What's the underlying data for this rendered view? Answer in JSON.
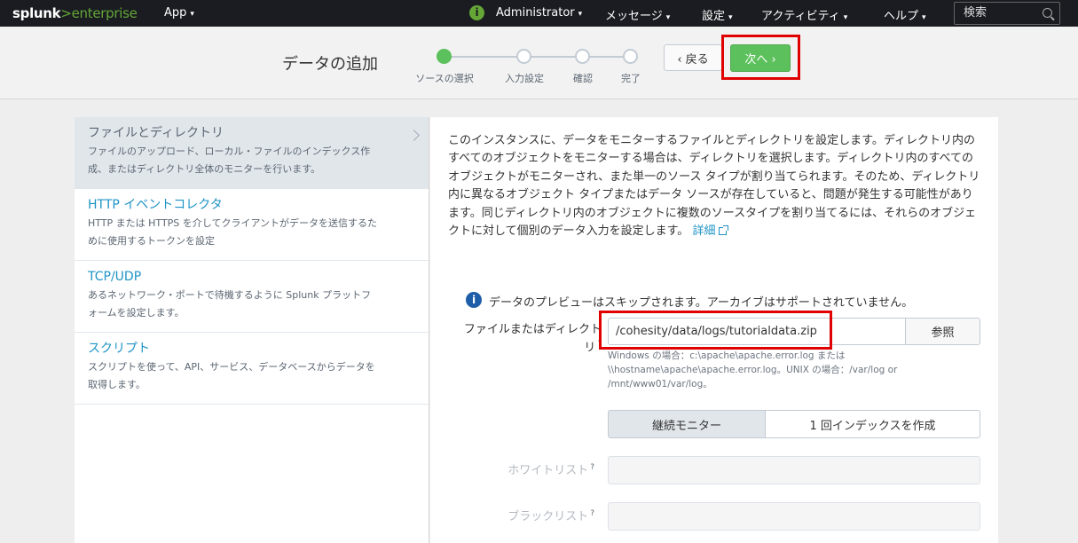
{
  "topbar": {
    "logo_main": "splunk",
    "logo_sep": ">",
    "logo_sub": "enterprise",
    "app_menu": "App",
    "info_glyph": "i",
    "user_menu": "Administrator",
    "messages_menu": "メッセージ",
    "settings_menu": "設定",
    "activity_menu": "アクティビティ",
    "help_menu": "ヘルプ",
    "search_placeholder": "検索",
    "caret": "▾"
  },
  "header": {
    "title": "データの追加",
    "steps": [
      {
        "label": "ソースの選択",
        "state": "active"
      },
      {
        "label": "入力設定",
        "state": "pending"
      },
      {
        "label": "確認",
        "state": "pending"
      },
      {
        "label": "完了",
        "state": "pending"
      }
    ],
    "back_label": "‹ 戻る",
    "next_label": "次へ ›"
  },
  "sources": [
    {
      "title": "ファイルとディレクトリ",
      "desc_line1": "ファイルのアップロード、ローカル・ファイルのインデックス作",
      "desc_line2": "成、またはディレクトリ全体のモニターを行います。",
      "selected": true
    },
    {
      "title": "HTTP イベントコレクタ",
      "desc_line1": "HTTP または HTTPS を介してクライアントがデータを送信するた",
      "desc_line2": "めに使用するトークンを設定",
      "selected": false
    },
    {
      "title": "TCP/UDP",
      "desc_line1": "あるネットワーク・ポートで待機するように Splunk プラットフ",
      "desc_line2": "ォームを設定します。",
      "selected": false
    },
    {
      "title": "スクリプト",
      "desc_line1": "スクリプトを使って、API、サービス、データベースからデータを",
      "desc_line2": "取得します。",
      "selected": false
    }
  ],
  "main": {
    "description": "このインスタンスに、データをモニターするファイルとディレクトリを設定します。ディレクトリ内のすべてのオブジェクトをモニターする場合は、ディレクトリを選択します。ディレクトリ内のすべてのオブジェクトがモニターされ、また単一のソース タイプが割り当てられます。そのため、ディレクトリ内に異なるオブジェクト タイプまたはデータ ソースが存在していると、問題が発生する可能性があります。同じディレクトリ内のオブジェクトに複数のソースタイプを割り当てるには、それらのオブジェクトに対して個別のデータ入力を設定します。",
    "more_link": "詳細",
    "note": "データのプレビューはスキップされます。アーカイブはサポートされていません。",
    "note_glyph": "i",
    "file_label_line1": "ファイルまたはディレクト",
    "file_label_line2": "リ",
    "help_mark": "?",
    "file_value": "/cohesity/data/logs/tutorialdata.zip",
    "browse_label": "参照",
    "hint_line1": "Windows の場合：c:\\apache\\apache.error.log または",
    "hint_line2": "\\\\hostname\\apache\\apache.error.log。UNIX の場合：/var/log or",
    "hint_line3": "/mnt/www01/var/log。",
    "mode_continuous": "継続モニター",
    "mode_once": "1 回インデックスを作成",
    "whitelist_label": "ホワイトリスト",
    "blacklist_label": "ブラックリスト"
  },
  "colors": {
    "accent_green": "#5cc05c",
    "link_blue": "#1e93c6",
    "highlight_red": "#e00000",
    "topbar_bg": "#1a1c21"
  }
}
